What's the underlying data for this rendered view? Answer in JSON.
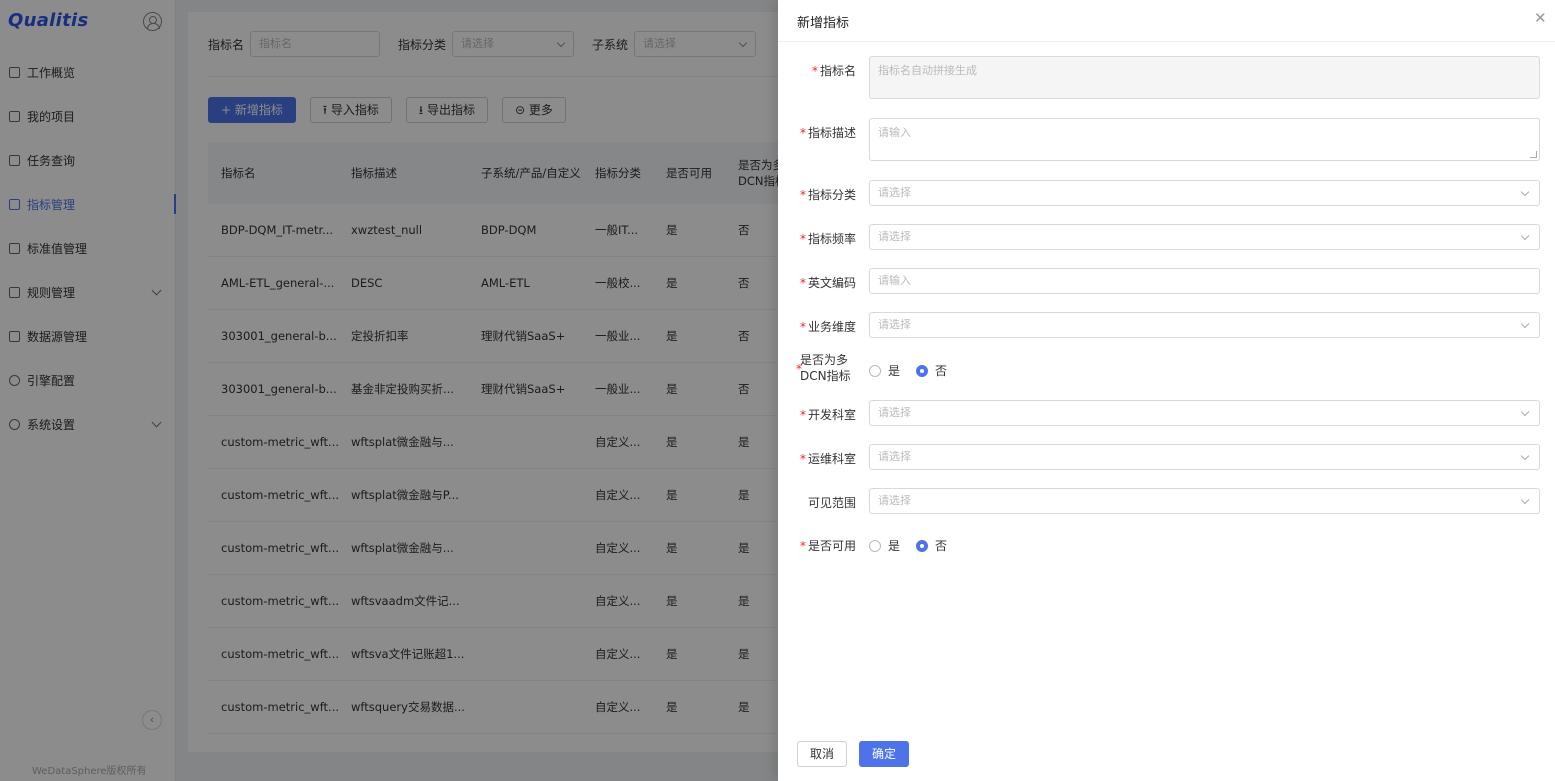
{
  "app": {
    "logo": "Qualitis",
    "copyright": "WeDataSphere版权所有"
  },
  "sidebar": {
    "items": [
      {
        "label": "工作概览"
      },
      {
        "label": "我的项目"
      },
      {
        "label": "任务查询"
      },
      {
        "label": "指标管理",
        "active": true
      },
      {
        "label": "标准值管理"
      },
      {
        "label": "规则管理",
        "expandable": true
      },
      {
        "label": "数据源管理"
      },
      {
        "label": "引擎配置"
      },
      {
        "label": "系统设置",
        "expandable": true
      }
    ],
    "collapse_icon": "‹"
  },
  "filters": {
    "name_label": "指标名",
    "name_placeholder": "指标名",
    "category_label": "指标分类",
    "category_placeholder": "请选择",
    "subsystem_label": "子系统",
    "subsystem_placeholder": "请选择"
  },
  "toolbar": {
    "add": "+ 新增指标",
    "import": "导入指标",
    "export": "导出指标",
    "more": "更多",
    "import_icon": "⭱",
    "export_icon": "⭳",
    "more_icon": "⊝"
  },
  "table": {
    "headers": [
      "指标名",
      "指标描述",
      "子系统/产品/自定义",
      "指标分类",
      "是否可用",
      "是否为多DCN指标"
    ],
    "rows": [
      [
        "BDP-DQM_IT-metr...",
        "xwztest_null",
        "BDP-DQM",
        "一般IT...",
        "是",
        "否"
      ],
      [
        "AML-ETL_general-...",
        "DESC",
        "AML-ETL",
        "一般校...",
        "是",
        "否"
      ],
      [
        "303001_general-b...",
        "定投折扣率",
        "理财代销SaaS+",
        "一般业...",
        "是",
        "否"
      ],
      [
        "303001_general-b...",
        "基金非定投购买折...",
        "理财代销SaaS+",
        "一般业...",
        "是",
        "否"
      ],
      [
        "custom-metric_wft...",
        "wftsplat微金融与...",
        "",
        "自定义...",
        "是",
        "是"
      ],
      [
        "custom-metric_wft...",
        "wftsplat微金融与P...",
        "",
        "自定义...",
        "是",
        "是"
      ],
      [
        "custom-metric_wft...",
        "wftsplat微金融与...",
        "",
        "自定义...",
        "是",
        "是"
      ],
      [
        "custom-metric_wft...",
        "wftsvaadm文件记...",
        "",
        "自定义...",
        "是",
        "是"
      ],
      [
        "custom-metric_wft...",
        "wftsva文件记账超1...",
        "",
        "自定义...",
        "是",
        "是"
      ],
      [
        "custom-metric_wft...",
        "wftsquery交易数据...",
        "",
        "自定义...",
        "是",
        "是"
      ]
    ]
  },
  "drawer": {
    "title": "新增指标",
    "close": "✕",
    "fields": {
      "name": {
        "label": "指标名",
        "placeholder": "指标名自动拼接生成"
      },
      "desc": {
        "label": "指标描述",
        "placeholder": "请输入"
      },
      "category": {
        "label": "指标分类",
        "placeholder": "请选择"
      },
      "frequency": {
        "label": "指标频率",
        "placeholder": "请选择"
      },
      "en_code": {
        "label": "英文编码",
        "placeholder": "请输入"
      },
      "dimension": {
        "label": "业务维度",
        "placeholder": "请选择"
      },
      "multi_dcn": {
        "label": "是否为多DCN指标",
        "yes": "是",
        "no": "否",
        "selected": "否"
      },
      "dev_dept": {
        "label": "开发科室",
        "placeholder": "请选择"
      },
      "ops_dept": {
        "label": "运维科室",
        "placeholder": "请选择"
      },
      "visibility": {
        "label": "可见范围",
        "placeholder": "请选择"
      },
      "available": {
        "label": "是否可用",
        "yes": "是",
        "no": "否",
        "selected": "否"
      }
    },
    "cancel": "取消",
    "confirm": "确定"
  }
}
